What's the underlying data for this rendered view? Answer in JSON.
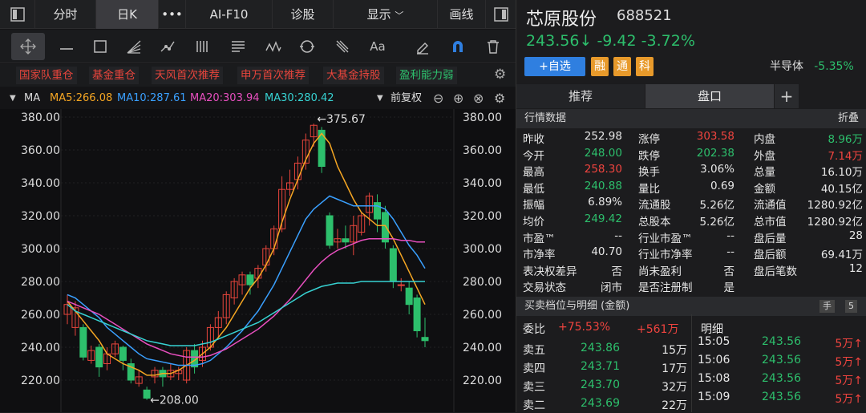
{
  "tabs": [
    "分时",
    "日K",
    "•••",
    "AI-F10",
    "诊股",
    "显示",
    "画线"
  ],
  "tags": [
    "国家队重仓",
    "基金重仓",
    "天风首次推荐",
    "申万首次推荐",
    "大基金持股",
    "盈利能力弱"
  ],
  "ma": {
    "name": "MA",
    "ma5": "MA5:266.08",
    "ma10": "MA10:287.61",
    "ma20": "MA20:303.94",
    "ma30": "MA30:280.42",
    "adj": "前复权"
  },
  "stock": {
    "name": "芯原股份",
    "code": "688521",
    "price": "243.56↓",
    "chg": "-9.42",
    "pct": "-3.72%",
    "add": "+自选",
    "b1": "融",
    "b2": "通",
    "b3": "科",
    "sector": "半导体",
    "sector_pct": "-5.35%"
  },
  "rtabs": [
    "推荐",
    "盘口",
    "+"
  ],
  "quote_title": "行情数据",
  "fold": "折叠",
  "quote_rows": [
    [
      "昨收",
      "252.98",
      "w",
      "涨停",
      "303.58",
      "r",
      "内盘",
      "8.96万",
      "g"
    ],
    [
      "今开",
      "248.00",
      "g",
      "跌停",
      "202.38",
      "g",
      "外盘",
      "7.14万",
      "r"
    ],
    [
      "最高",
      "258.30",
      "r",
      "换手",
      "3.06%",
      "w",
      "总量",
      "16.10万",
      "w"
    ],
    [
      "最低",
      "240.88",
      "g",
      "量比",
      "0.69",
      "w",
      "金额",
      "40.15亿",
      "w"
    ],
    [
      "振幅",
      "6.89%",
      "w",
      "流通股",
      "5.26亿",
      "w",
      "流通值",
      "1280.92亿",
      "w"
    ],
    [
      "均价",
      "249.42",
      "g",
      "总股本",
      "5.26亿",
      "w",
      "总市值",
      "1280.92亿",
      "w"
    ],
    [
      "市盈™",
      "--",
      "w",
      "行业市盈™",
      "--",
      "w",
      "盘后量",
      "28",
      "w"
    ],
    [
      "市净率",
      "40.70",
      "w",
      "行业市净率",
      "--",
      "w",
      "盘后额",
      "69.41万",
      "w"
    ],
    [
      "表决权差异",
      "否",
      "w",
      "尚未盈利",
      "否",
      "w",
      "盘后笔数",
      "12",
      "w"
    ],
    [
      "交易状态",
      "闭市",
      "w",
      "是否注册制",
      "是",
      "w",
      "",
      "",
      " w"
    ]
  ],
  "depth_title": "买卖档位与明细 (金额)",
  "hand": "手",
  "five": "5",
  "weibi": {
    "label": "委比",
    "pct": "+75.53%",
    "val": "+561万"
  },
  "mingxi": "明细",
  "asks": [
    [
      "卖五",
      "243.86",
      "15万"
    ],
    [
      "卖四",
      "243.71",
      "17万"
    ],
    [
      "卖三",
      "243.70",
      "32万"
    ],
    [
      "卖二",
      "243.69",
      "22万"
    ]
  ],
  "ticks": [
    [
      "15:05",
      "243.56",
      "5万↑"
    ],
    [
      "15:06",
      "243.56",
      "5万↑"
    ],
    [
      "15:08",
      "243.56",
      "5万↑"
    ],
    [
      "15:09",
      "243.56",
      "5万↑"
    ]
  ],
  "chart_data": {
    "type": "candlestick",
    "yticks": [
      "380.00",
      "360.00",
      "340.00",
      "320.00",
      "300.00",
      "280.00",
      "260.00",
      "240.00",
      "220.00"
    ],
    "ylim": [
      200,
      385
    ],
    "annot_high": "←375.67",
    "annot_low": "←208.00",
    "candles": [
      [
        260,
        266,
        272,
        254
      ],
      [
        252,
        264,
        268,
        247
      ],
      [
        252,
        234,
        254,
        232
      ],
      [
        232,
        238,
        241,
        230
      ],
      [
        240,
        228,
        242,
        222
      ],
      [
        230,
        236,
        240,
        226
      ],
      [
        236,
        242,
        244,
        234
      ],
      [
        240,
        232,
        241,
        226
      ],
      [
        230,
        220,
        233,
        218
      ],
      [
        218,
        222,
        226,
        216
      ],
      [
        214,
        209,
        216,
        208
      ],
      [
        222,
        226,
        228,
        218
      ],
      [
        226,
        222,
        228,
        216
      ],
      [
        222,
        226,
        230,
        220
      ],
      [
        224,
        226,
        228,
        220
      ],
      [
        220,
        238,
        240,
        218
      ],
      [
        238,
        228,
        242,
        224
      ],
      [
        232,
        240,
        244,
        228
      ],
      [
        240,
        252,
        254,
        238
      ],
      [
        252,
        258,
        262,
        246
      ],
      [
        258,
        272,
        274,
        254
      ],
      [
        270,
        280,
        282,
        266
      ],
      [
        278,
        284,
        286,
        272
      ],
      [
        284,
        278,
        286,
        272
      ],
      [
        282,
        288,
        290,
        276
      ],
      [
        290,
        300,
        302,
        286
      ],
      [
        300,
        312,
        314,
        296
      ],
      [
        312,
        336,
        344,
        310
      ],
      [
        336,
        340,
        348,
        332
      ],
      [
        342,
        352,
        356,
        336
      ],
      [
        352,
        366,
        370,
        348
      ],
      [
        368,
        375,
        376,
        362
      ],
      [
        372,
        350,
        374,
        346
      ],
      [
        320,
        302,
        322,
        300
      ],
      [
        304,
        306,
        312,
        300
      ],
      [
        306,
        304,
        314,
        300
      ],
      [
        304,
        314,
        320,
        296
      ],
      [
        310,
        320,
        322,
        308
      ],
      [
        322,
        332,
        334,
        314
      ],
      [
        328,
        318,
        333,
        310
      ],
      [
        322,
        304,
        326,
        300
      ],
      [
        300,
        280,
        302,
        276
      ],
      [
        278,
        278,
        282,
        274
      ],
      [
        276,
        266,
        280,
        260
      ],
      [
        270,
        250,
        272,
        246
      ],
      [
        246,
        244,
        258,
        240
      ]
    ],
    "ma5": [
      268,
      262,
      256,
      250,
      244,
      236,
      233,
      230,
      228,
      226,
      223,
      223,
      224,
      224,
      226,
      229,
      232,
      236,
      240,
      246,
      252,
      260,
      268,
      276,
      282,
      290,
      300,
      316,
      330,
      342,
      354,
      364,
      370,
      364,
      350,
      340,
      330,
      322,
      318,
      314,
      314,
      306,
      296,
      286,
      276,
      266
    ],
    "ma10": [
      272,
      270,
      266,
      262,
      258,
      252,
      248,
      244,
      240,
      236,
      233,
      232,
      231,
      230,
      229,
      229,
      229,
      230,
      232,
      236,
      240,
      245,
      250,
      256,
      262,
      270,
      278,
      288,
      298,
      308,
      318,
      324,
      328,
      332,
      330,
      328,
      326,
      326,
      326,
      326,
      324,
      318,
      310,
      302,
      296,
      288
    ],
    "ma20": [
      268,
      266,
      264,
      262,
      260,
      257,
      254,
      251,
      248,
      245,
      242,
      240,
      238,
      236,
      235,
      234,
      234,
      234,
      235,
      237,
      239,
      242,
      245,
      248,
      251,
      255,
      259,
      264,
      269,
      275,
      281,
      287,
      292,
      296,
      299,
      301,
      303,
      305,
      306,
      306,
      306,
      306,
      305,
      305,
      304,
      304
    ],
    "ma30": [
      266,
      262,
      260,
      258,
      256,
      254,
      252,
      250,
      248,
      246,
      244,
      243,
      242,
      241,
      241,
      241,
      241,
      242,
      243,
      245,
      247,
      249,
      251,
      253,
      255,
      258,
      261,
      264,
      267,
      270,
      273,
      275,
      277,
      278,
      279,
      279,
      279,
      280,
      280,
      280,
      280,
      280,
      280,
      280,
      280,
      280
    ]
  }
}
